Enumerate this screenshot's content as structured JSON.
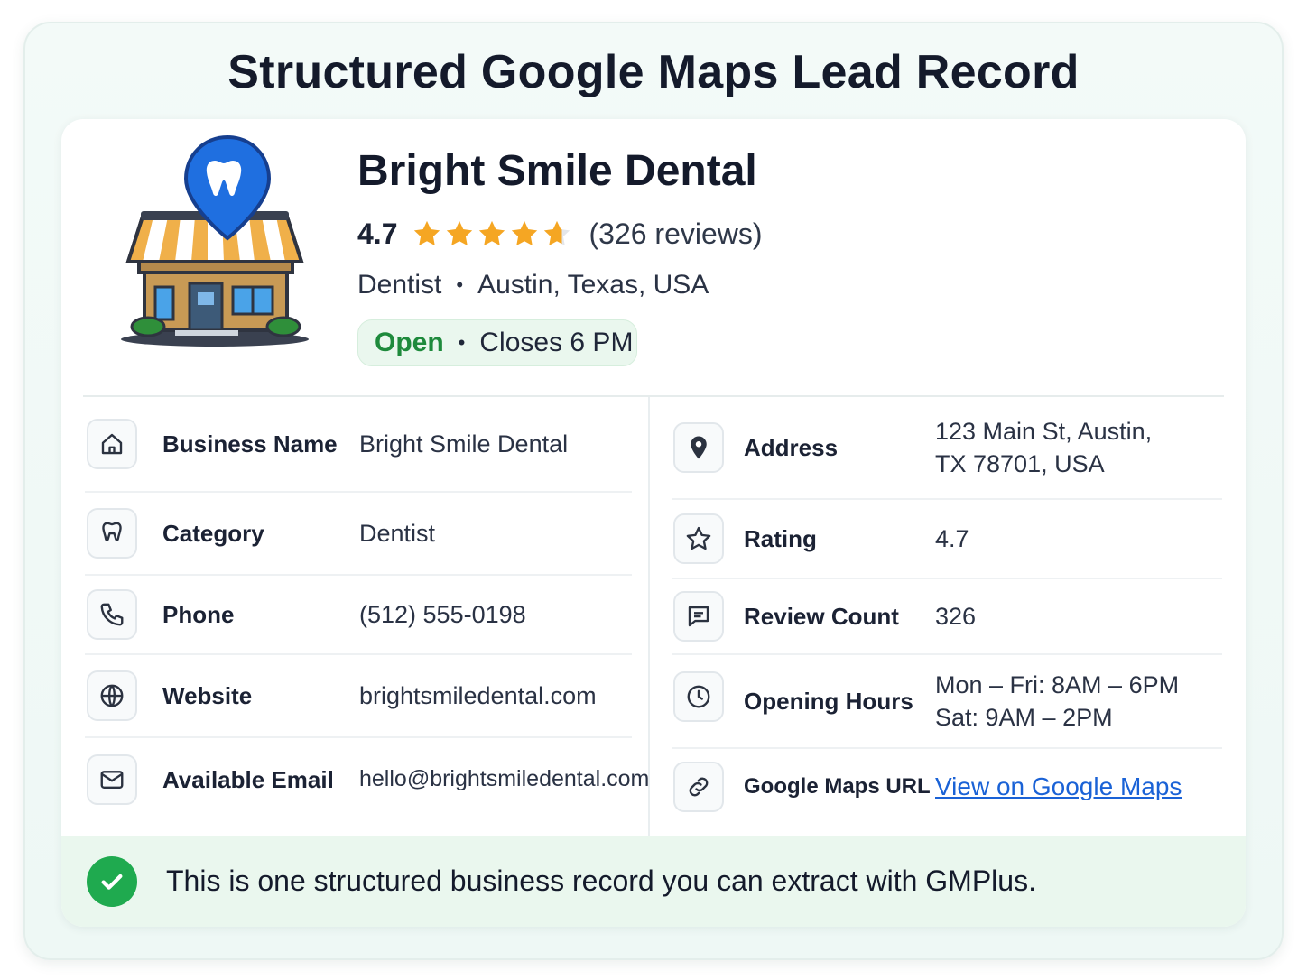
{
  "title": "Structured Google Maps Lead Record",
  "business": {
    "name": "Bright Smile Dental",
    "rating": "4.7",
    "stars": 4.7,
    "reviews_text": "(326 reviews)",
    "category": "Dentist",
    "dot": "•",
    "location": "Austin, Texas, USA",
    "status": "Open",
    "hours_summary": "Closes 6 PM"
  },
  "fields_left": [
    {
      "icon": "home-icon",
      "label": "Business Name",
      "value": "Bright Smile Dental"
    },
    {
      "icon": "tooth-icon",
      "label": "Category",
      "value": "Dentist"
    },
    {
      "icon": "phone-icon",
      "label": "Phone",
      "value": "(512) 555-0198"
    },
    {
      "icon": "globe-icon",
      "label": "Website",
      "value": "brightsmiledental.com"
    },
    {
      "icon": "mail-icon",
      "label": "Available Email",
      "value": "hello@brightsmiledental.com"
    }
  ],
  "fields_right": [
    {
      "icon": "map-pin-icon",
      "label": "Address",
      "value_line1": "123 Main St, Austin,",
      "value_line2": "TX 78701, USA"
    },
    {
      "icon": "star-icon",
      "label": "Rating",
      "value": "4.7"
    },
    {
      "icon": "chat-icon",
      "label": "Review Count",
      "value": "326"
    },
    {
      "icon": "clock-icon",
      "label": "Opening Hours",
      "value_line1": "Mon – Fri:  8AM – 6PM",
      "value_line2": "Sat: 9AM – 2PM"
    },
    {
      "icon": "link-icon",
      "label": "Google Maps URL",
      "value": "View on Google Maps"
    }
  ],
  "footer": {
    "icon": "check-circle-icon",
    "text": "This is one structured business record you can extract with GMPlus."
  },
  "colors": {
    "open_green": "#1e8a3c",
    "star_gold": "#f5a623",
    "link_blue": "#1a62d6",
    "pin_blue": "#1f6fe0",
    "check_green": "#1faa4f"
  }
}
